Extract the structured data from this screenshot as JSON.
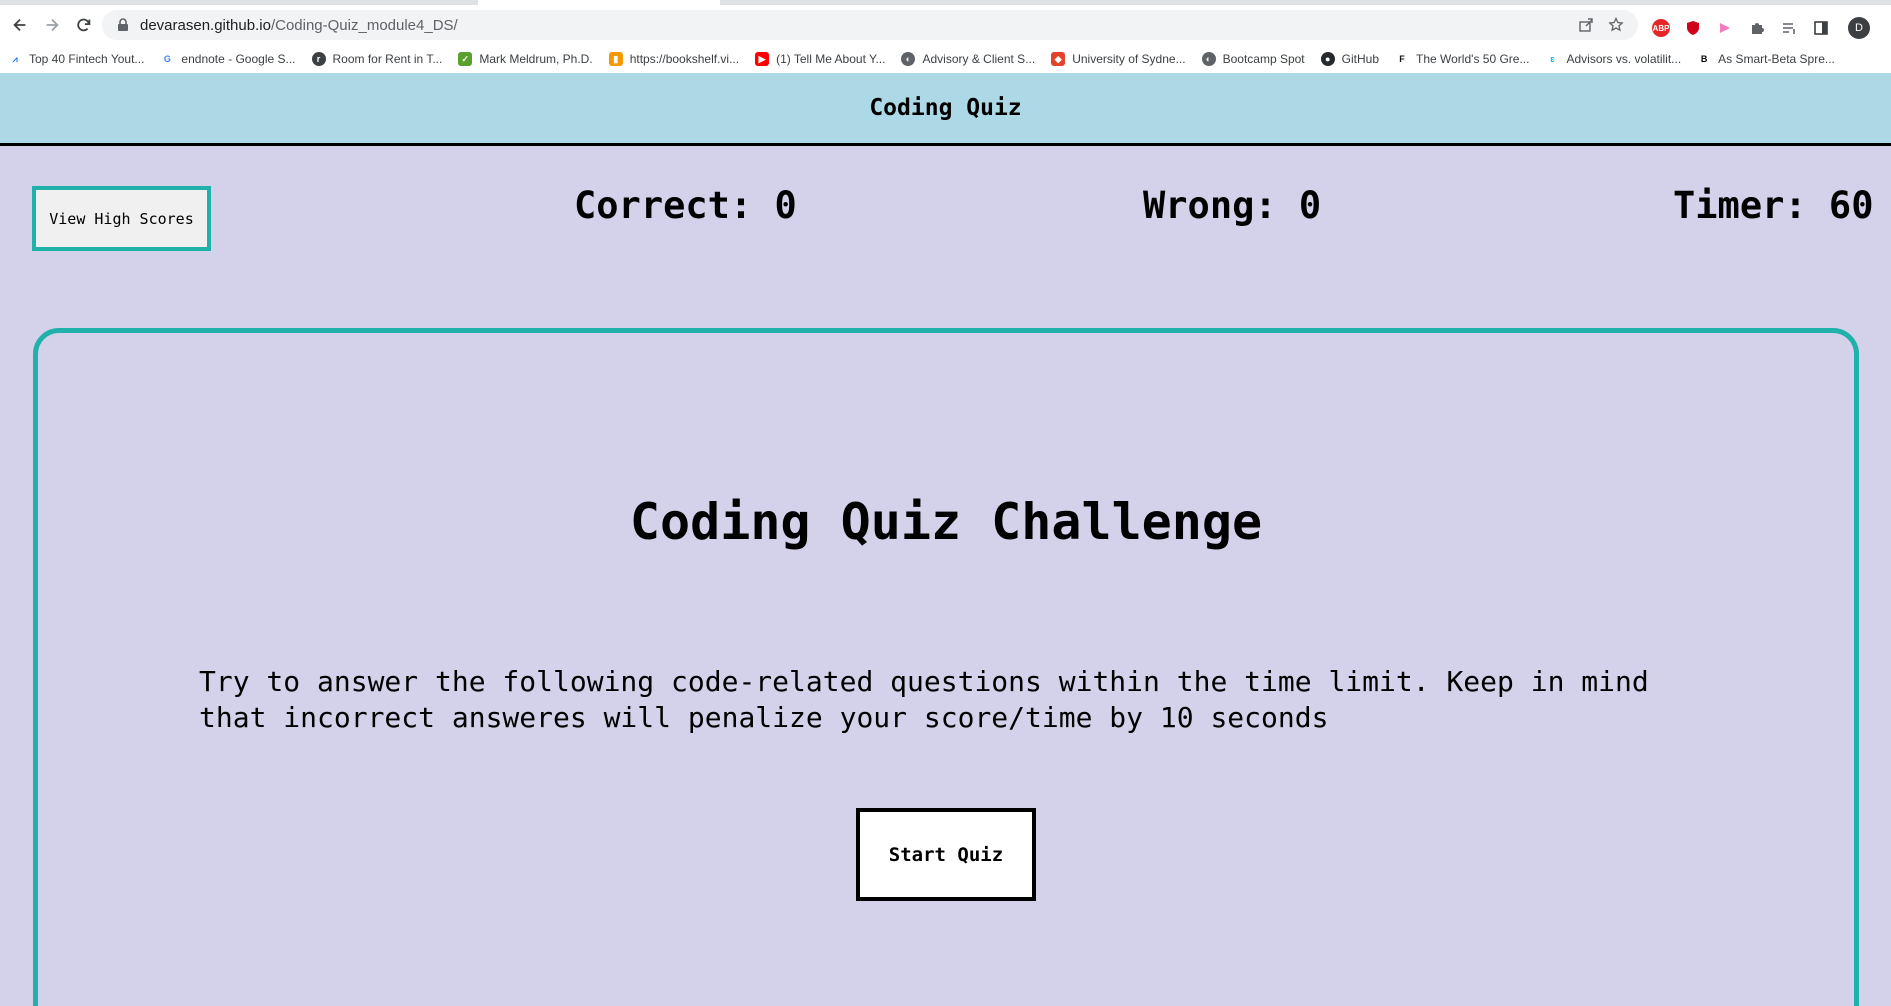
{
  "browser": {
    "url_host": "devarasen.github.io",
    "url_path": "/Coding-Quiz_module4_DS/",
    "profile_initial": "D",
    "extensions": [
      {
        "icon": "abp-icon",
        "color": "#e3262a"
      },
      {
        "icon": "shield-icon",
        "color": "#d0021b"
      },
      {
        "icon": "dots-extension-icon",
        "color": "#f57ac0"
      },
      {
        "icon": "puzzle-icon",
        "color": "#5f6368"
      },
      {
        "icon": "reading-list-icon",
        "color": "#5f6368"
      },
      {
        "icon": "side-panel-icon",
        "color": "#5f6368"
      }
    ],
    "bookmarks": [
      {
        "label": "Top 40 Fintech Yout...",
        "icon": "chart-favicon",
        "color": "#1a73e8"
      },
      {
        "label": "endnote - Google S...",
        "icon": "google-favicon",
        "color": "#ffffff"
      },
      {
        "label": "Room for Rent in T...",
        "icon": "room-favicon",
        "color": "#3c4043"
      },
      {
        "label": "Mark Meldrum, Ph.D.",
        "icon": "check-favicon",
        "color": "#5aa02c"
      },
      {
        "label": "https://bookshelf.vi...",
        "icon": "bookshelf-favicon",
        "color": "#f29900"
      },
      {
        "label": "(1) Tell Me About Y...",
        "icon": "youtube-favicon",
        "color": "#ff0000"
      },
      {
        "label": "Advisory & Client S...",
        "icon": "globe-favicon",
        "color": "#5f6368"
      },
      {
        "label": "University of Sydne...",
        "icon": "gitlab-favicon",
        "color": "#e24329"
      },
      {
        "label": "Bootcamp Spot",
        "icon": "globe-favicon",
        "color": "#5f6368"
      },
      {
        "label": "GitHub",
        "icon": "github-favicon",
        "color": "#24292e"
      },
      {
        "label": "The World's 50 Gre...",
        "icon": "fortune-favicon",
        "color": "#111111"
      },
      {
        "label": "Advisors vs. volatilit...",
        "icon": "advisors-favicon",
        "color": "#00b5e2"
      },
      {
        "label": "As Smart-Beta Spre...",
        "icon": "b-favicon",
        "color": "#000000"
      }
    ]
  },
  "header": {
    "title": "Coding Quiz"
  },
  "scoreboard": {
    "high_scores_label": "View High Scores",
    "correct_text": "Correct: 0",
    "wrong_text": "Wrong: 0",
    "timer_text": "Timer: 60"
  },
  "quiz": {
    "heading": "Coding Quiz Challenge",
    "intro": "Try to answer the following code-related questions within the time limit. Keep in mind that incorrect answeres will penalize your score/time by 10 seconds",
    "start_label": "Start Quiz"
  },
  "colors": {
    "header_bg": "#add8e6",
    "page_bg": "#d4d2ea",
    "accent_teal": "#20b2aa"
  }
}
